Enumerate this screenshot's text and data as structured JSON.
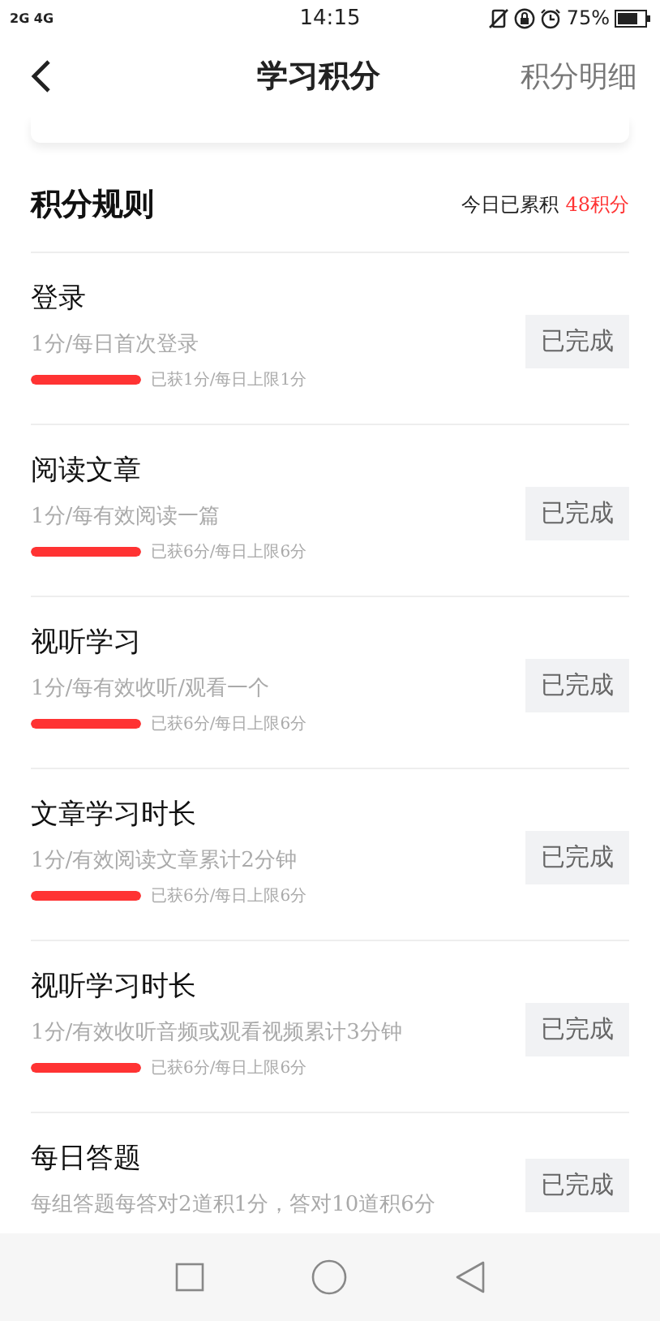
{
  "status_bar": {
    "network": "2G 4G",
    "time": "14:15",
    "battery": "75%"
  },
  "header": {
    "title": "学习积分",
    "action": "积分明细"
  },
  "rules": {
    "title": "积分规则",
    "summary_label": "今日已累积",
    "summary_value": "48积分",
    "items": [
      {
        "title": "登录",
        "description": "1分/每日首次登录",
        "level": 1,
        "progress": "已获1分/每日上限1分",
        "button": "已完成",
        "done": true
      },
      {
        "title": "阅读文章",
        "description": "1分/每有效阅读一篇",
        "level": 1,
        "progress": "已获6分/每日上限6分",
        "button": "已完成",
        "done": true
      },
      {
        "title": "视听学习",
        "description": "1分/每有效收听/观看一个",
        "level": 1,
        "progress": "已获6分/每日上限6分",
        "button": "已完成",
        "done": true
      },
      {
        "title": "文章学习时长",
        "description": "1分/有效阅读文章累计2分钟",
        "level": 1,
        "progress": "已获6分/每日上限6分",
        "button": "已完成",
        "done": true
      },
      {
        "title": "视听学习时长",
        "description": "1分/有效收听音频或观看视频累计3分钟",
        "level": 1,
        "progress": "已获6分/每日上限6分",
        "button": "已完成",
        "done": true
      },
      {
        "title": "每日答题",
        "description": "每组答题每答对2道积1分，答对10道积6分",
        "button": "已完成",
        "done": true
      }
    ]
  }
}
